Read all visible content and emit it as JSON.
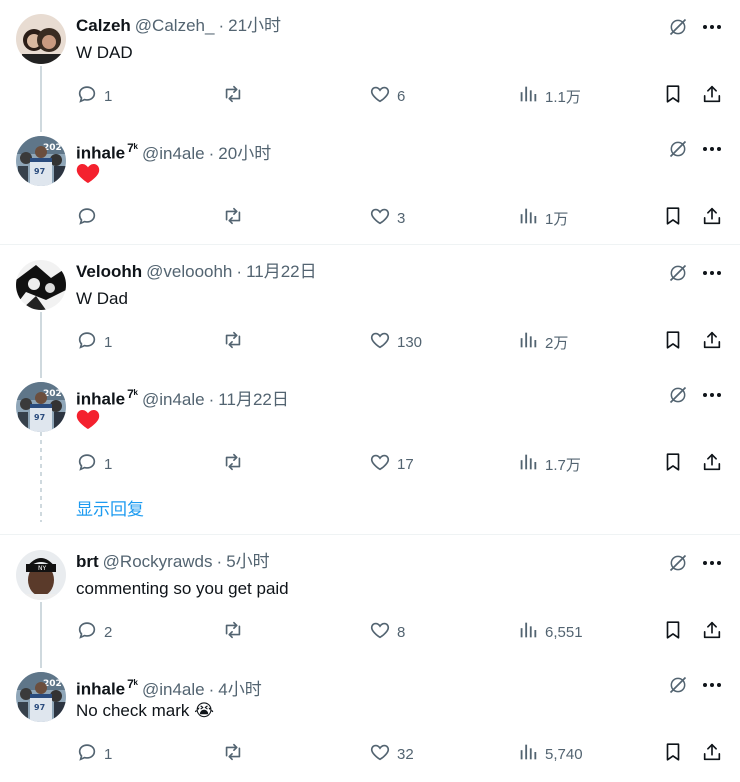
{
  "tweets": [
    {
      "name": "Calzeh",
      "badge": "",
      "handle": "@Calzeh_",
      "time": "21小时",
      "text": "W DAD",
      "reply": "1",
      "repost": "",
      "like": "6",
      "views": "1.1万",
      "avatar": "calzeh"
    },
    {
      "name": "inhale",
      "badge": "7ᵏ",
      "handle": "@in4ale",
      "time": "20小时",
      "text": "",
      "emoji": "heart",
      "reply": "",
      "repost": "",
      "like": "3",
      "views": "1万",
      "avatar": "inhale"
    },
    {
      "name": "Veloohh",
      "badge": "",
      "handle": "@velooohh",
      "time": "11月22日",
      "text": "W Dad",
      "reply": "1",
      "repost": "",
      "like": "130",
      "views": "2万",
      "avatar": "veloohh"
    },
    {
      "name": "inhale",
      "badge": "7ᵏ",
      "handle": "@in4ale",
      "time": "11月22日",
      "text": "",
      "emoji": "heart",
      "reply": "1",
      "repost": "",
      "like": "17",
      "views": "1.7万",
      "avatar": "inhale"
    },
    {
      "name": "brt",
      "badge": "",
      "handle": "@Rockyrawds",
      "time": "5小时",
      "text": "commenting so you get paid",
      "reply": "2",
      "repost": "",
      "like": "8",
      "views": "6,551",
      "avatar": "brt"
    },
    {
      "name": "inhale",
      "badge": "7ᵏ",
      "handle": "@in4ale",
      "time": "4小时",
      "text": "No check mark",
      "emoji_after": "😭",
      "reply": "1",
      "repost": "",
      "like": "32",
      "views": "5,740",
      "avatar": "inhale"
    }
  ],
  "show_replies_label": "显示回复",
  "dot": "·",
  "colors": {
    "accent": "#1d9bf0",
    "muted": "#536471",
    "heart": "#f91880",
    "line": "#cfd9de"
  }
}
